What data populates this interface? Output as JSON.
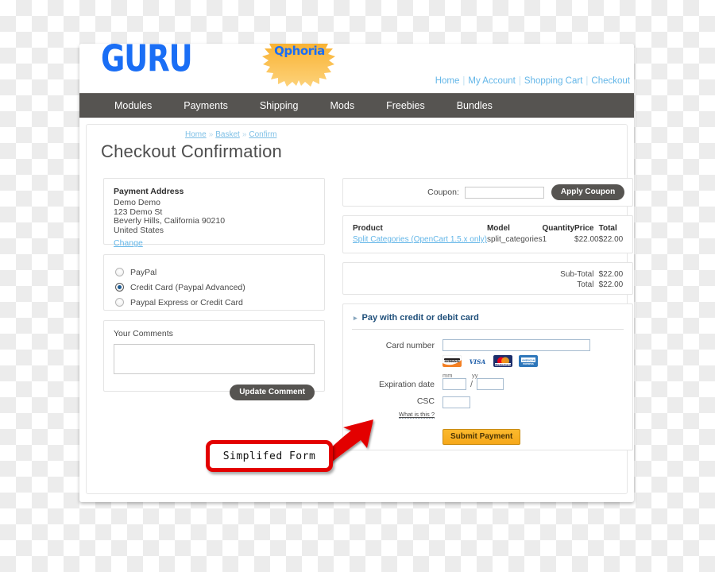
{
  "header": {
    "logo_text": "GURU",
    "badge_text": "Qphoria",
    "top_links": [
      "Home",
      "My Account",
      "Shopping Cart",
      "Checkout"
    ],
    "nav_items": [
      "Modules",
      "Payments",
      "Shipping",
      "Mods",
      "Freebies",
      "Bundles"
    ]
  },
  "breadcrumb": {
    "items": [
      "Home",
      "Basket",
      "Confirm"
    ],
    "separator": "»"
  },
  "page": {
    "title": "Checkout Confirmation"
  },
  "payment_address": {
    "heading": "Payment Address",
    "lines": [
      "Demo Demo",
      "123 Demo St",
      "Beverly Hills, California 90210",
      "United States"
    ],
    "change_link": "Change"
  },
  "payment_methods": {
    "options": [
      {
        "label": "PayPal",
        "selected": false
      },
      {
        "label": "Credit Card (Paypal Advanced)",
        "selected": true
      },
      {
        "label": "Paypal Express or Credit Card",
        "selected": false
      }
    ]
  },
  "comments": {
    "title": "Your Comments",
    "value": "",
    "placeholder": "",
    "button_label": "Update Comment"
  },
  "coupon": {
    "label": "Coupon:",
    "value": "",
    "placeholder": "",
    "button_label": "Apply Coupon"
  },
  "cart": {
    "columns": [
      "Product",
      "Model",
      "Quantity",
      "Price",
      "Total"
    ],
    "rows": [
      {
        "product": "Split Categories (OpenCart 1.5.x only)",
        "model": "split_categories",
        "quantity": "1",
        "price": "$22.00",
        "total": "$22.00"
      }
    ],
    "totals": [
      {
        "label": "Sub-Total",
        "amount": "$22.00"
      },
      {
        "label": "Total",
        "amount": "$22.00"
      }
    ]
  },
  "credit_card_form": {
    "heading": "Pay with credit or debit card",
    "card_number_label": "Card number",
    "card_number_value": "",
    "accepted_cards": [
      "discover-card-icon",
      "visa-card-icon",
      "mastercard-card-icon",
      "amex-card-icon"
    ],
    "expiration_label": "Expiration date",
    "month_hint": "mm",
    "year_hint": "yy",
    "month_value": "",
    "year_value": "",
    "separator": "/",
    "csc_label": "CSC",
    "csc_help_link": "What is this ?",
    "csc_value": "",
    "submit_label": "Submit Payment"
  },
  "annotation": {
    "text": "Simplifed Form",
    "box_color": "#e30000",
    "arrow_color": "#e30000"
  },
  "colors": {
    "nav_bg": "#565451",
    "link_blue": "#63b6e8",
    "logo_blue": "#1a6ef5",
    "badge_orange": "#f5a623",
    "submit_orange": "#f6a81a",
    "title_gray": "#4e4e4e"
  }
}
